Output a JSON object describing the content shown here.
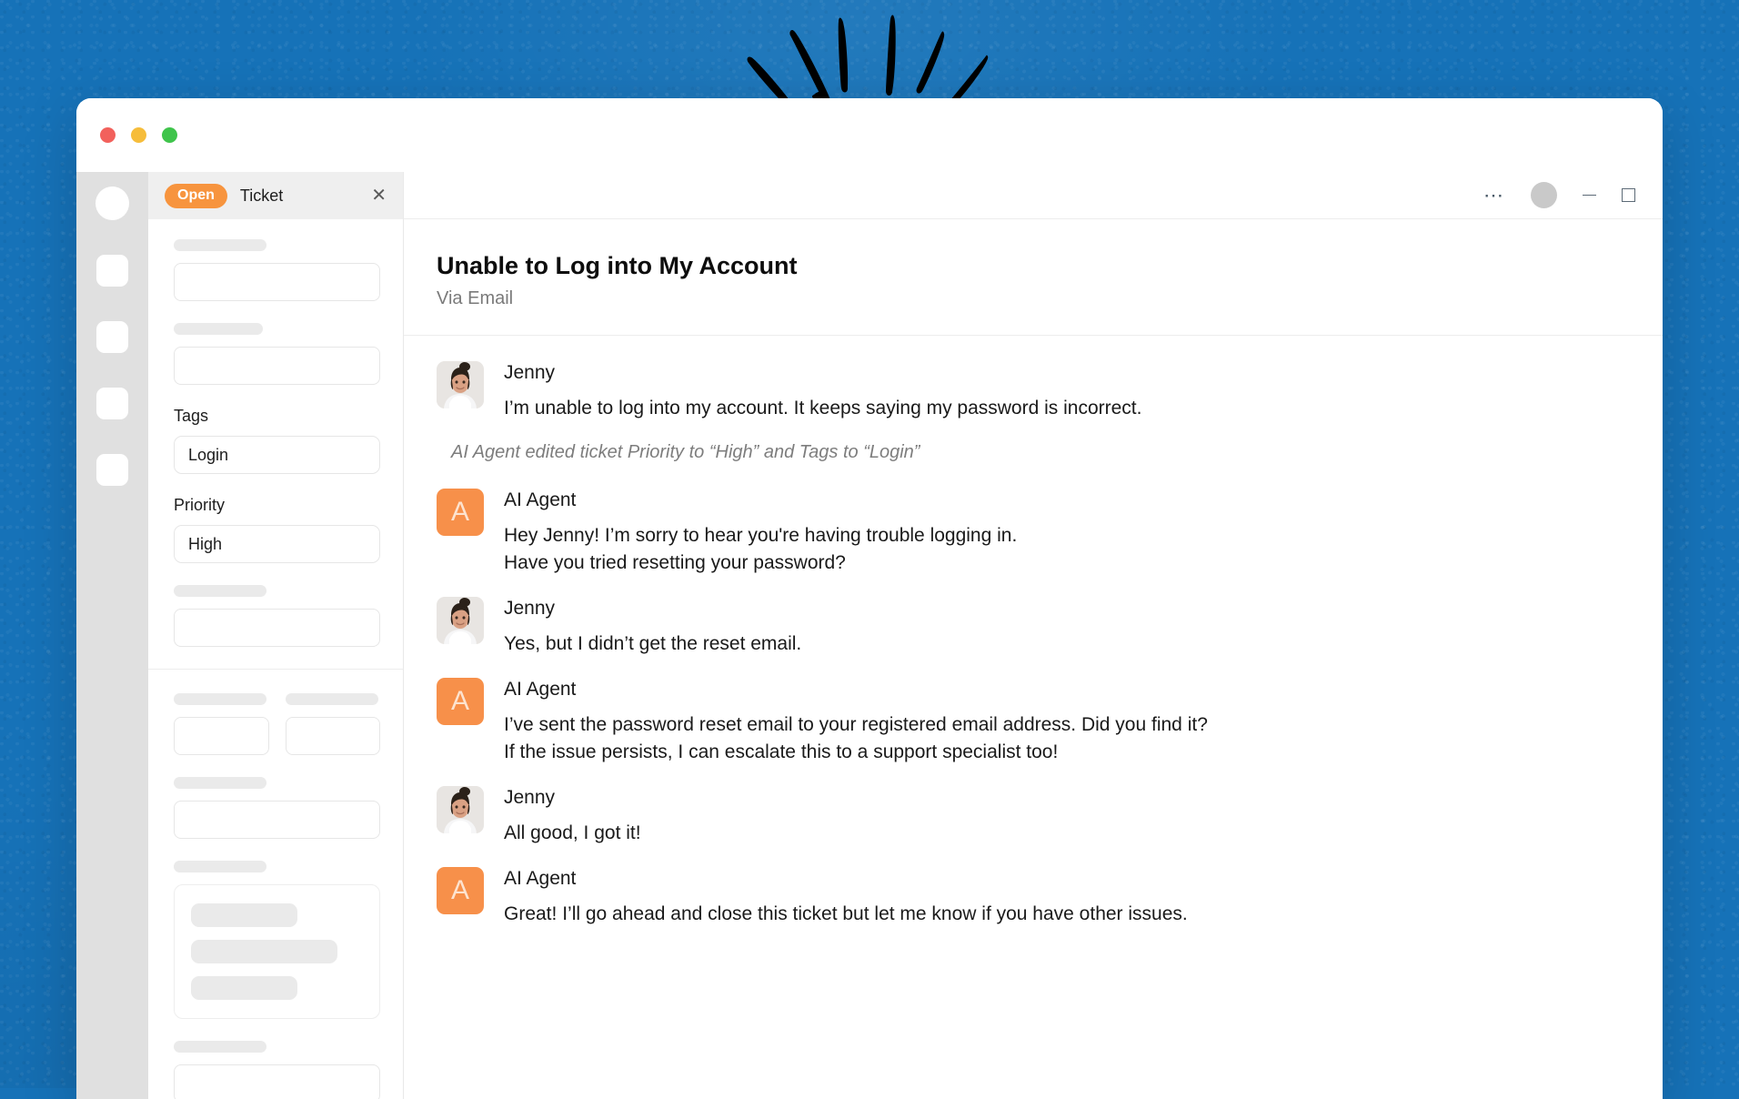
{
  "theme": {
    "backdrop_color": "#1672b8",
    "accent_orange": "#f7943e",
    "ai_avatar_orange": "#f7904a",
    "rail_gray": "#e0e0e0",
    "tabbar_gray": "#efefef"
  },
  "window": {
    "traffic_lights": [
      "close-red",
      "minimize-yellow",
      "maximize-green"
    ]
  },
  "rail": {
    "avatar_icon": "user-avatar-icon",
    "buttons": [
      {
        "icon": "nav-placeholder-icon-1"
      },
      {
        "icon": "nav-placeholder-icon-2"
      },
      {
        "icon": "nav-placeholder-icon-3"
      },
      {
        "icon": "nav-placeholder-icon-4"
      }
    ]
  },
  "sidebar": {
    "tab": {
      "status_badge": "Open",
      "title": "Ticket",
      "close_icon": "close-icon"
    },
    "fields": [
      {
        "label": "Tags",
        "value": "Login"
      },
      {
        "label": "Priority",
        "value": "High"
      }
    ]
  },
  "main": {
    "topbar": {
      "overflow_icon": "ellipsis-icon",
      "avatar_icon": "account-avatar-icon",
      "minimize_icon": "window-minimize-icon",
      "maximize_icon": "window-maximize-icon"
    },
    "ticket": {
      "title": "Unable to Log into My Account",
      "channel": "Via Email"
    },
    "system_note": "AI Agent edited ticket Priority to “High” and Tags to “Login”",
    "messages": [
      {
        "author": "Jenny",
        "avatar": "photo",
        "avatar_initial": "",
        "lines": [
          "I’m unable to log into my account. It keeps saying my password is incorrect."
        ]
      },
      {
        "author": "AI Agent",
        "avatar": "initial",
        "avatar_initial": "A",
        "lines": [
          "Hey Jenny! I’m sorry to hear you're having trouble logging in.",
          "Have you tried resetting your password?"
        ]
      },
      {
        "author": "Jenny",
        "avatar": "photo",
        "avatar_initial": "",
        "lines": [
          "Yes, but I didn’t get the reset email."
        ]
      },
      {
        "author": "AI Agent",
        "avatar": "initial",
        "avatar_initial": "A",
        "lines": [
          "I’ve sent the password reset email to your registered email address. Did you find it?",
          "If the issue persists, I can escalate this to a support specialist too!"
        ]
      },
      {
        "author": "Jenny",
        "avatar": "photo",
        "avatar_initial": "",
        "lines": [
          "All good, I got it!"
        ]
      },
      {
        "author": "AI Agent",
        "avatar": "initial",
        "avatar_initial": "A",
        "lines": [
          "Great! I’ll go ahead and close this ticket but let me know if you have other issues."
        ]
      }
    ]
  }
}
